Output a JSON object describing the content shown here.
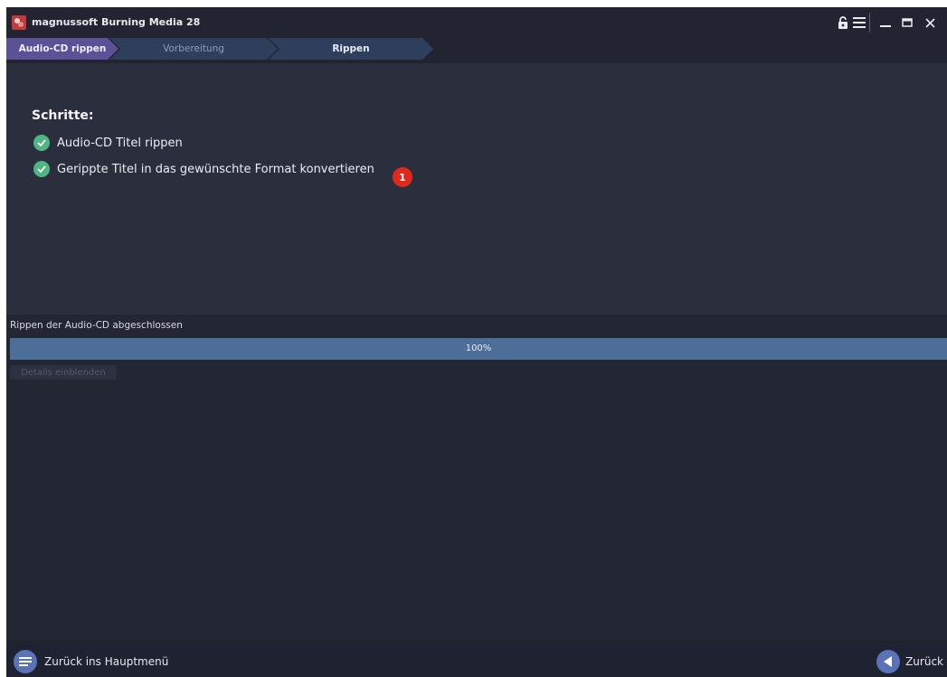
{
  "window": {
    "title": "magnussoft Burning Media 28"
  },
  "titlebar": {
    "icons": [
      "lock-icon",
      "menu-icon",
      "minimize-icon",
      "maximize-icon",
      "close-icon"
    ]
  },
  "breadcrumb": {
    "steps": [
      {
        "label": "Audio-CD rippen",
        "state": "active"
      },
      {
        "label": "Vorbereitung",
        "state": "inactive"
      },
      {
        "label": "Rippen",
        "state": "current"
      }
    ]
  },
  "main": {
    "heading": "Schritte:",
    "tasks": [
      {
        "label": "Audio-CD Titel rippen",
        "status": "done"
      },
      {
        "label": "Gerippte Titel in das gewünschte Format konvertieren",
        "status": "done"
      }
    ],
    "badge": "1"
  },
  "progress": {
    "status_text": "Rippen der Audio-CD abgeschlossen",
    "percent_label": "100%",
    "value": 1.0,
    "details_label": "Details einblenden"
  },
  "bottom": {
    "home_label": "Zurück ins Hauptmenü",
    "back_label": "Zurück"
  },
  "colors": {
    "background": "#232633",
    "panel": "#2b2e3d",
    "active_step": "#5b5197",
    "inactive_step": "#2e3f5e",
    "check": "#4fb583",
    "badge": "#e0281d",
    "progress_fill": "#4e6e9a",
    "button_accent": "#5a73b8"
  }
}
